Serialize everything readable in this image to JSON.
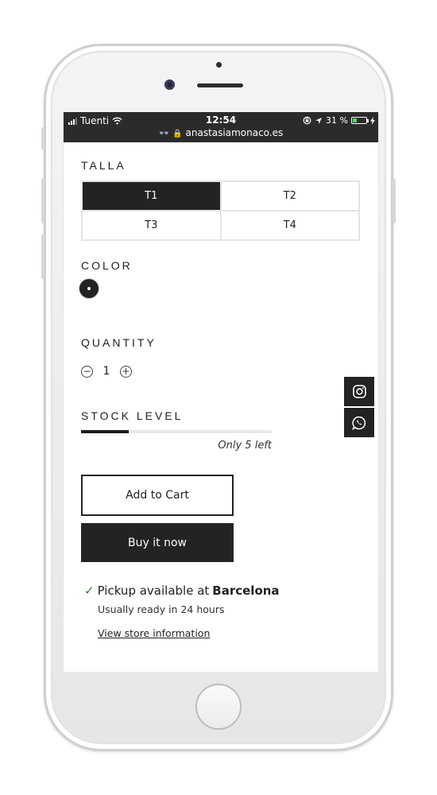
{
  "status_bar": {
    "carrier": "Tuenti",
    "time": "12:54",
    "battery": "31 %",
    "battery_level": 0.31,
    "url": "anastasiamonaco.es"
  },
  "size": {
    "title": "TALLA",
    "options": [
      "T1",
      "T2",
      "T3",
      "T4"
    ],
    "selected": "T1"
  },
  "color": {
    "title": "COLOR"
  },
  "quantity": {
    "title": "QUANTITY",
    "value": "1",
    "minus_icon": "minus-circle-icon",
    "plus_icon": "plus-circle-icon"
  },
  "stock": {
    "title": "STOCK LEVEL",
    "note": "Only 5 left",
    "level": 0.25
  },
  "actions": {
    "add_to_cart": "Add to Cart",
    "buy_now": "Buy it now"
  },
  "pickup": {
    "prefix": "Pickup available at",
    "location": "Barcelona",
    "ready": "Usually ready in 24 hours",
    "link": "View store information"
  },
  "colors": {
    "dark": "#232323",
    "status_bar": "#2b2b2b",
    "check": "#2e7d32",
    "battery": "#4cd964"
  }
}
